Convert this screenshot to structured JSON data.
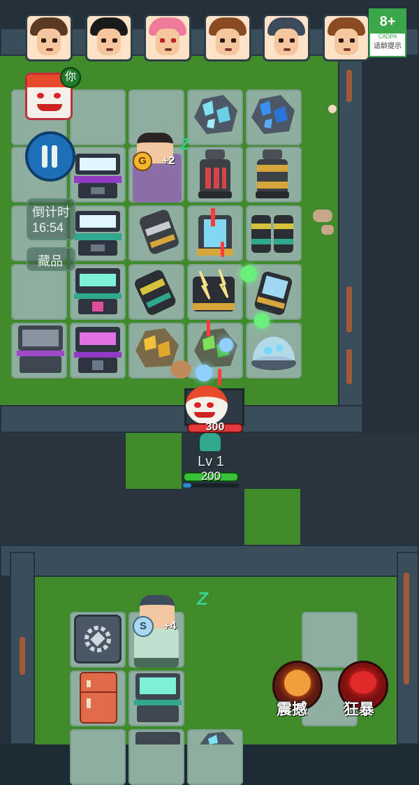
{
  "age_rating": {
    "value": "8+",
    "org": "CADPA",
    "caption": "适龄提示"
  },
  "player_tag": "你",
  "timer": {
    "label": "倒计时",
    "value": "16:54"
  },
  "collection_label": "藏品",
  "player": {
    "hp": "300",
    "level": "Lv 1",
    "energy": "200"
  },
  "beds": [
    {
      "bonus": "+2",
      "coin": "G"
    },
    {
      "bonus": "+4",
      "coin": "S"
    }
  ],
  "skills": [
    {
      "label": "震撼",
      "icon": "shock-skill-icon"
    },
    {
      "label": "狂暴",
      "icon": "rage-skill-icon"
    }
  ],
  "colors": {
    "grass": "#3f8a2a",
    "tile": "#8fae9f",
    "wall": "#3a4d5b",
    "hp": "#e33b3b",
    "energy": "#38c23a",
    "accent": "#1d6fb8"
  }
}
